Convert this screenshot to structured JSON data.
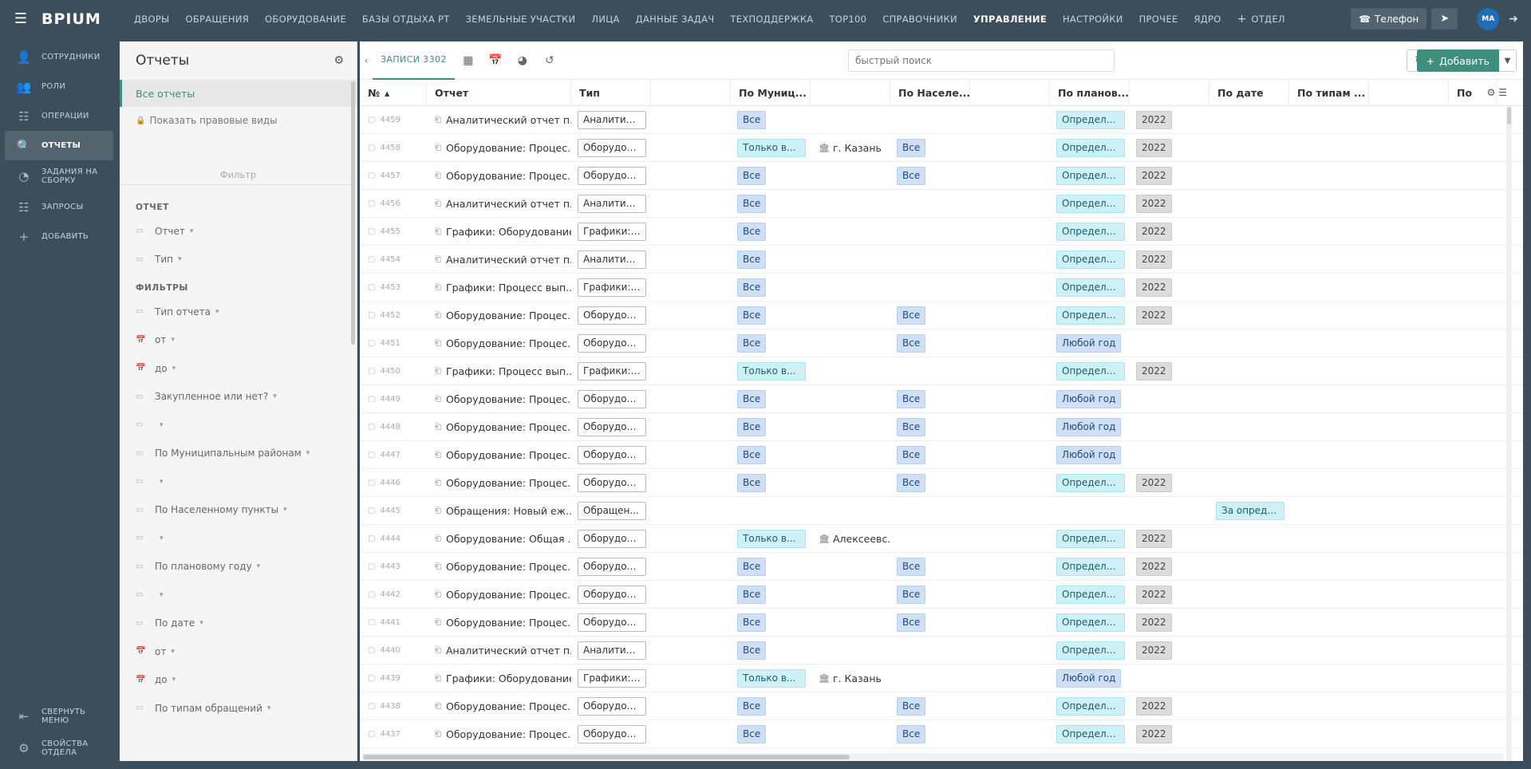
{
  "topbar": {
    "logo": "BPIUM",
    "nav": [
      "ДВОРЫ",
      "ОБРАЩЕНИЯ",
      "ОБОРУДОВАНИЕ",
      "БАЗЫ ОТДЫХА РТ",
      "ЗЕМЕЛЬНЫЕ УЧАСТКИ",
      "ЛИЦА",
      "ДАННЫЕ ЗАДАЧ",
      "ТЕХПОДДЕРЖКА",
      "ТОР100",
      "СПРАВОЧНИКИ",
      "УПРАВЛЕНИЕ",
      "НАСТРОЙКИ",
      "ПРОЧЕЕ",
      "ЯДРО"
    ],
    "active_index": 10,
    "add_dept": "ОТДЕЛ",
    "phone": "Телефон",
    "avatar": "MA"
  },
  "leftnav": {
    "items": [
      {
        "label": "СОТРУДНИКИ",
        "icon": "user-icon"
      },
      {
        "label": "РОЛИ",
        "icon": "roles-icon"
      },
      {
        "label": "ОПЕРАЦИИ",
        "icon": "operations-icon"
      },
      {
        "label": "ОТЧЕТЫ",
        "icon": "reports-icon"
      },
      {
        "label": "ЗАДАНИЯ НА СБОРКУ",
        "icon": "pie-icon"
      },
      {
        "label": "ЗАПРОСЫ",
        "icon": "requests-icon"
      },
      {
        "label": "ДОБАВИТЬ",
        "icon": "plus-icon"
      }
    ],
    "active_index": 3,
    "collapse": "СВЕРНУТЬ МЕНЮ",
    "dept_props": "СВОЙСТВА ОТДЕЛА"
  },
  "left_panel": {
    "title": "Отчеты",
    "all_reports": "Все отчеты",
    "show_legal": "Показать правовые виды",
    "filter_label": "Фильтр",
    "section_report": "ОТЧЕТ",
    "report_fields": [
      "Отчет",
      "Тип"
    ],
    "section_filters": "ФИЛЬТРЫ",
    "filter_fields": [
      "Тип отчета",
      "от",
      "до",
      "Закупленное или нет?",
      "",
      "По Муниципальным районам",
      "",
      "По Населенному пункты",
      "",
      "По плановому году",
      "",
      "По дате",
      "от",
      "до",
      "По типам обращений"
    ]
  },
  "toolbar": {
    "records_label": "ЗАПИСИ 3302",
    "search_placeholder": "быстрый поиск",
    "add_label": "Добавить"
  },
  "table": {
    "headers": [
      "№",
      "Отчет",
      "Тип",
      "",
      "По Муниц...",
      "",
      "По Населе...",
      "",
      "По планов...",
      "",
      "По дате",
      "По типам ...",
      "",
      "По"
    ],
    "rows": [
      {
        "num": "4459",
        "report": "Аналитический отчет п...",
        "type": "Аналитич...",
        "mun": "Все",
        "mun_kind": "blue",
        "place": "",
        "settle": "",
        "plan": "Определе...",
        "plan_kind": "cyan",
        "year": "2022",
        "date": ""
      },
      {
        "num": "4458",
        "report": "Оборудование: Процес...",
        "type": "Оборудов...",
        "mun": "Только в...",
        "mun_kind": "cyan",
        "place": "г. Казань",
        "settle": "Все",
        "plan": "Определе...",
        "plan_kind": "cyan",
        "year": "2022",
        "date": ""
      },
      {
        "num": "4457",
        "report": "Оборудование: Процес...",
        "type": "Оборудов...",
        "mun": "Все",
        "mun_kind": "blue",
        "place": "",
        "settle": "Все",
        "plan": "Определе...",
        "plan_kind": "cyan",
        "year": "2022",
        "date": ""
      },
      {
        "num": "4456",
        "report": "Аналитический отчет п...",
        "type": "Аналитич...",
        "mun": "Все",
        "mun_kind": "blue",
        "place": "",
        "settle": "",
        "plan": "Определе...",
        "plan_kind": "cyan",
        "year": "2022",
        "date": ""
      },
      {
        "num": "4455",
        "report": "Графики: Оборудование",
        "type": "Графики: ...",
        "mun": "Все",
        "mun_kind": "blue",
        "place": "",
        "settle": "",
        "plan": "Определе...",
        "plan_kind": "cyan",
        "year": "2022",
        "date": ""
      },
      {
        "num": "4454",
        "report": "Аналитический отчет п...",
        "type": "Аналитич...",
        "mun": "Все",
        "mun_kind": "blue",
        "place": "",
        "settle": "",
        "plan": "Определе...",
        "plan_kind": "cyan",
        "year": "2022",
        "date": ""
      },
      {
        "num": "4453",
        "report": "Графики: Процесс вып...",
        "type": "Графики: ...",
        "mun": "Все",
        "mun_kind": "blue",
        "place": "",
        "settle": "",
        "plan": "Определе...",
        "plan_kind": "cyan",
        "year": "2022",
        "date": ""
      },
      {
        "num": "4452",
        "report": "Оборудование: Процес...",
        "type": "Оборудов...",
        "mun": "Все",
        "mun_kind": "blue",
        "place": "",
        "settle": "Все",
        "plan": "Определе...",
        "plan_kind": "cyan",
        "year": "2022",
        "date": ""
      },
      {
        "num": "4451",
        "report": "Оборудование: Процес...",
        "type": "Оборудов...",
        "mun": "Все",
        "mun_kind": "blue",
        "place": "",
        "settle": "Все",
        "plan": "Любой год",
        "plan_kind": "blue",
        "year": "",
        "date": ""
      },
      {
        "num": "4450",
        "report": "Графики: Процесс вып...",
        "type": "Графики: ...",
        "mun": "Только в...",
        "mun_kind": "cyan",
        "place": "",
        "settle": "",
        "plan": "Определе...",
        "plan_kind": "cyan",
        "year": "2022",
        "date": ""
      },
      {
        "num": "4449",
        "report": "Оборудование: Процес...",
        "type": "Оборудов...",
        "mun": "Все",
        "mun_kind": "blue",
        "place": "",
        "settle": "Все",
        "plan": "Любой год",
        "plan_kind": "blue",
        "year": "",
        "date": ""
      },
      {
        "num": "4448",
        "report": "Оборудование: Процес...",
        "type": "Оборудов...",
        "mun": "Все",
        "mun_kind": "blue",
        "place": "",
        "settle": "Все",
        "plan": "Любой год",
        "plan_kind": "blue",
        "year": "",
        "date": ""
      },
      {
        "num": "4447",
        "report": "Оборудование: Процес...",
        "type": "Оборудов...",
        "mun": "Все",
        "mun_kind": "blue",
        "place": "",
        "settle": "Все",
        "plan": "Любой год",
        "plan_kind": "blue",
        "year": "",
        "date": ""
      },
      {
        "num": "4446",
        "report": "Оборудование: Процес...",
        "type": "Оборудов...",
        "mun": "Все",
        "mun_kind": "blue",
        "place": "",
        "settle": "Все",
        "plan": "Определе...",
        "plan_kind": "cyan",
        "year": "2022",
        "date": ""
      },
      {
        "num": "4445",
        "report": "Обращения: Новый еж...",
        "type": "Обращен...",
        "mun": "",
        "mun_kind": "",
        "place": "",
        "settle": "",
        "plan": "",
        "plan_kind": "",
        "year": "",
        "date": "За опреде..."
      },
      {
        "num": "4444",
        "report": "Оборудование: Общая ...",
        "type": "Оборудов...",
        "mun": "Только в...",
        "mun_kind": "cyan",
        "place": "Алексеевс...",
        "settle": "",
        "plan": "Определе...",
        "plan_kind": "cyan",
        "year": "2022",
        "date": ""
      },
      {
        "num": "4443",
        "report": "Оборудование: Процес...",
        "type": "Оборудов...",
        "mun": "Все",
        "mun_kind": "blue",
        "place": "",
        "settle": "Все",
        "plan": "Определе...",
        "plan_kind": "cyan",
        "year": "2022",
        "date": ""
      },
      {
        "num": "4442",
        "report": "Оборудование: Процес...",
        "type": "Оборудов...",
        "mun": "Все",
        "mun_kind": "blue",
        "place": "",
        "settle": "Все",
        "plan": "Определе...",
        "plan_kind": "cyan",
        "year": "2022",
        "date": ""
      },
      {
        "num": "4441",
        "report": "Оборудование: Процес...",
        "type": "Оборудов...",
        "mun": "Все",
        "mun_kind": "blue",
        "place": "",
        "settle": "Все",
        "plan": "Определе...",
        "plan_kind": "cyan",
        "year": "2022",
        "date": ""
      },
      {
        "num": "4440",
        "report": "Аналитический отчет п...",
        "type": "Аналитич...",
        "mun": "Все",
        "mun_kind": "blue",
        "place": "",
        "settle": "",
        "plan": "Определе...",
        "plan_kind": "cyan",
        "year": "2022",
        "date": ""
      },
      {
        "num": "4439",
        "report": "Графики: Оборудование",
        "type": "Графики: ...",
        "mun": "Только в...",
        "mun_kind": "cyan",
        "place": "г. Казань",
        "settle": "",
        "plan": "Любой год",
        "plan_kind": "blue",
        "year": "",
        "date": ""
      },
      {
        "num": "4438",
        "report": "Оборудование: Процес...",
        "type": "Оборудов...",
        "mun": "Все",
        "mun_kind": "blue",
        "place": "",
        "settle": "Все",
        "plan": "Определе...",
        "plan_kind": "cyan",
        "year": "2022",
        "date": ""
      },
      {
        "num": "4437",
        "report": "Оборудование: Процес...",
        "type": "Оборудов...",
        "mun": "Все",
        "mun_kind": "blue",
        "place": "",
        "settle": "Все",
        "plan": "Определе...",
        "plan_kind": "cyan",
        "year": "2022",
        "date": ""
      }
    ]
  },
  "colors": {
    "accent": "#3e8e7e",
    "chrome": "#3c4d5c",
    "tag_blue": "#cfe0f6",
    "tag_cyan": "#cdf1f6"
  }
}
